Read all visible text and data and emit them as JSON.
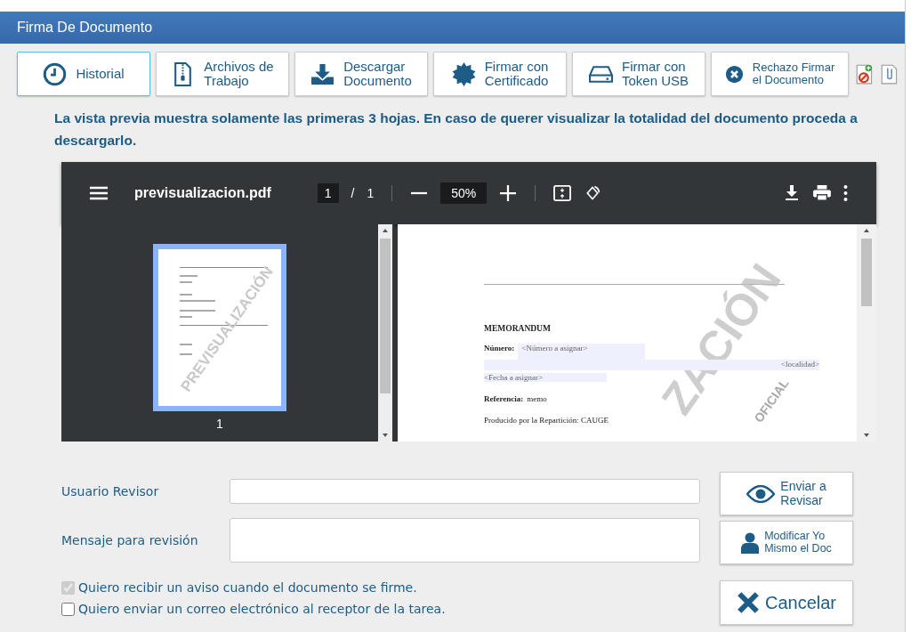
{
  "window": {
    "title": "Firma De Documento"
  },
  "toolbar": [
    {
      "kind": "history",
      "lines": [
        "Historial"
      ],
      "selected": true
    },
    {
      "kind": "zip",
      "lines": [
        "Archivos de",
        "Trabajo"
      ],
      "selected": false
    },
    {
      "kind": "download",
      "lines": [
        "Descargar",
        "Documento"
      ],
      "selected": false
    },
    {
      "kind": "seal",
      "lines": [
        "Firmar con",
        "Certificado"
      ],
      "selected": false
    },
    {
      "kind": "drive",
      "lines": [
        "Firmar con",
        "Token USB"
      ],
      "selected": false
    },
    {
      "kind": "reject",
      "lines": [
        "Rechazo Firmar",
        "el Documento"
      ],
      "selected": false
    }
  ],
  "notice": "La vista previa muestra solamente las primeras 3 hojas. En caso de querer visualizar la totalidad del documento proceda a descargarlo.",
  "viewer": {
    "file_name": "previsualizacion.pdf",
    "page": "1",
    "separator": "/",
    "page_total": "1",
    "zoom": "50%",
    "thumbnails": [
      {
        "label": "1",
        "selected": true,
        "watermark": "PREVISUALIZACIÓN"
      }
    ],
    "document": {
      "heading": "MEMORANDUM",
      "number_label": "Número:",
      "number_value": "<Número a asignar>",
      "locality": "<localidad>",
      "date": "<Fecha a asignar>",
      "reference_label": "Referencia:",
      "reference_value": "memo",
      "producer": "Producido por la Repartición: CAUGE",
      "watermark": [
        "ZACIÓN",
        "OFICIAL"
      ]
    }
  },
  "form": {
    "fields": [
      {
        "kind": "input",
        "label": "Usuario Revisor"
      },
      {
        "kind": "textarea",
        "label": "Mensaje para revisión"
      }
    ],
    "checkboxes": [
      {
        "label": "Quiero recibir un aviso cuando el documento se firme.",
        "checked": true,
        "disabled": true
      },
      {
        "label": "Quiero enviar un correo electrónico al receptor de la tarea.",
        "checked": false,
        "disabled": false
      }
    ],
    "actions": [
      {
        "kind": "eye",
        "lines": [
          "Enviar a",
          "Revisar"
        ]
      },
      {
        "kind": "person",
        "lines": [
          "Modificar Yo",
          "Mismo el Doc"
        ]
      },
      {
        "kind": "cancel",
        "lines": [
          "Cancelar"
        ]
      }
    ]
  }
}
